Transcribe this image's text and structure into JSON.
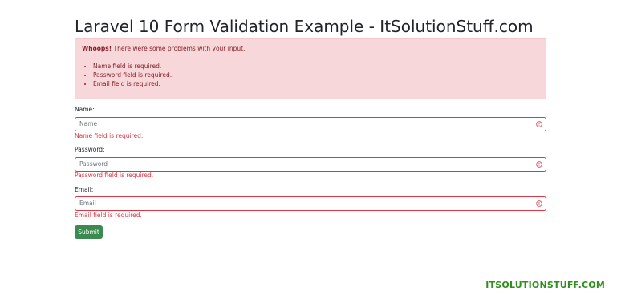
{
  "page": {
    "title": "Laravel 10 Form Validation Example - ItSolutionStuff.com"
  },
  "alert": {
    "strong": "Whoops!",
    "message": " There were some problems with your input.",
    "errors": [
      "Name field is required.",
      "Password field is required.",
      "Email field is required."
    ],
    "bg_color": "#f8d7da",
    "text_color": "#842029"
  },
  "form": {
    "fields": [
      {
        "label": "Name:",
        "placeholder": "Name",
        "value": "",
        "error": "Name field is required.",
        "icon": "error-circle-icon"
      },
      {
        "label": "Password:",
        "placeholder": "Password",
        "value": "",
        "error": "Password field is required.",
        "icon": "error-circle-icon"
      },
      {
        "label": "Email:",
        "placeholder": "Email",
        "value": "",
        "error": "Email field is required.",
        "icon": "error-circle-icon"
      }
    ],
    "submit_label": "Submit",
    "error_color": "#dc3545",
    "submit_color": "#3b8a50"
  },
  "watermark": {
    "text": "ITSOLUTIONSTUFF.COM",
    "color": "#2f8f1e"
  }
}
